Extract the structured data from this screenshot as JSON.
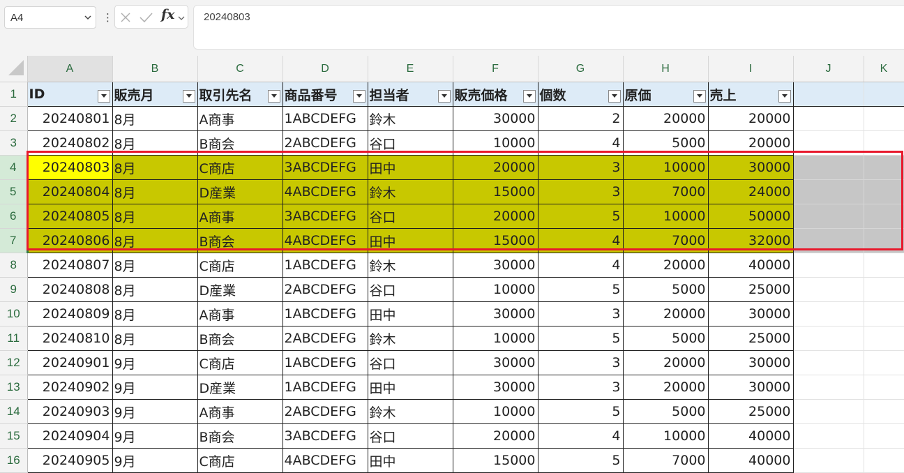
{
  "namebox": {
    "value": "A4"
  },
  "formula_bar": {
    "value": "20240803",
    "fx_label": "fx"
  },
  "columns": [
    "A",
    "B",
    "C",
    "D",
    "E",
    "F",
    "G",
    "H",
    "I",
    "J",
    "K"
  ],
  "headers": [
    "ID",
    "販売月",
    "取引先名",
    "商品番号",
    "担当者",
    "販売価格",
    "個数",
    "原価",
    "売上"
  ],
  "rows": [
    {
      "num": "1"
    },
    {
      "num": "2",
      "cells": [
        "20240801",
        "8月",
        "A商事",
        "1ABCDEFG",
        "鈴木",
        "30000",
        "2",
        "20000",
        "20000"
      ]
    },
    {
      "num": "3",
      "cells": [
        "20240802",
        "8月",
        "B商会",
        "2ABCDEFG",
        "谷口",
        "10000",
        "4",
        "5000",
        "20000"
      ]
    },
    {
      "num": "4",
      "cells": [
        "20240803",
        "8月",
        "C商店",
        "3ABCDEFG",
        "田中",
        "20000",
        "3",
        "10000",
        "30000"
      ]
    },
    {
      "num": "5",
      "cells": [
        "20240804",
        "8月",
        "D産業",
        "4ABCDEFG",
        "鈴木",
        "15000",
        "3",
        "7000",
        "24000"
      ]
    },
    {
      "num": "6",
      "cells": [
        "20240805",
        "8月",
        "A商事",
        "3ABCDEFG",
        "谷口",
        "20000",
        "5",
        "10000",
        "50000"
      ]
    },
    {
      "num": "7",
      "cells": [
        "20240806",
        "8月",
        "B商会",
        "4ABCDEFG",
        "田中",
        "15000",
        "4",
        "7000",
        "32000"
      ]
    },
    {
      "num": "8",
      "cells": [
        "20240807",
        "8月",
        "C商店",
        "1ABCDEFG",
        "鈴木",
        "30000",
        "4",
        "20000",
        "40000"
      ]
    },
    {
      "num": "9",
      "cells": [
        "20240808",
        "8月",
        "D産業",
        "2ABCDEFG",
        "谷口",
        "10000",
        "5",
        "5000",
        "25000"
      ]
    },
    {
      "num": "10",
      "cells": [
        "20240809",
        "8月",
        "A商事",
        "1ABCDEFG",
        "田中",
        "30000",
        "3",
        "20000",
        "30000"
      ]
    },
    {
      "num": "11",
      "cells": [
        "20240810",
        "8月",
        "B商会",
        "2ABCDEFG",
        "鈴木",
        "10000",
        "5",
        "5000",
        "25000"
      ]
    },
    {
      "num": "12",
      "cells": [
        "20240901",
        "9月",
        "C商店",
        "1ABCDEFG",
        "谷口",
        "30000",
        "3",
        "20000",
        "30000"
      ]
    },
    {
      "num": "13",
      "cells": [
        "20240902",
        "9月",
        "D産業",
        "1ABCDEFG",
        "田中",
        "30000",
        "3",
        "20000",
        "30000"
      ]
    },
    {
      "num": "14",
      "cells": [
        "20240903",
        "9月",
        "A商事",
        "2ABCDEFG",
        "鈴木",
        "10000",
        "5",
        "5000",
        "25000"
      ]
    },
    {
      "num": "15",
      "cells": [
        "20240904",
        "9月",
        "B商会",
        "3ABCDEFG",
        "谷口",
        "20000",
        "4",
        "10000",
        "40000"
      ]
    },
    {
      "num": "16",
      "cells": [
        "20240905",
        "9月",
        "C商店",
        "4ABCDEFG",
        "田中",
        "15000",
        "5",
        "7000",
        "40000"
      ]
    }
  ],
  "selection": {
    "active_cell": "A4",
    "selected_rows": [
      "4",
      "5",
      "6",
      "7"
    ]
  },
  "colors": {
    "highlight_fill": "#c8c800",
    "active_cell_fill": "#ffff00",
    "outside_selection_fill": "#c6c6c6",
    "selection_outline": "#e8192c",
    "header_fill": "#ddebf7"
  },
  "icons": {
    "namebox_arrow": "chevron-down-icon",
    "cancel": "close-icon",
    "enter": "check-icon",
    "filter": "filter-dropdown-icon"
  }
}
